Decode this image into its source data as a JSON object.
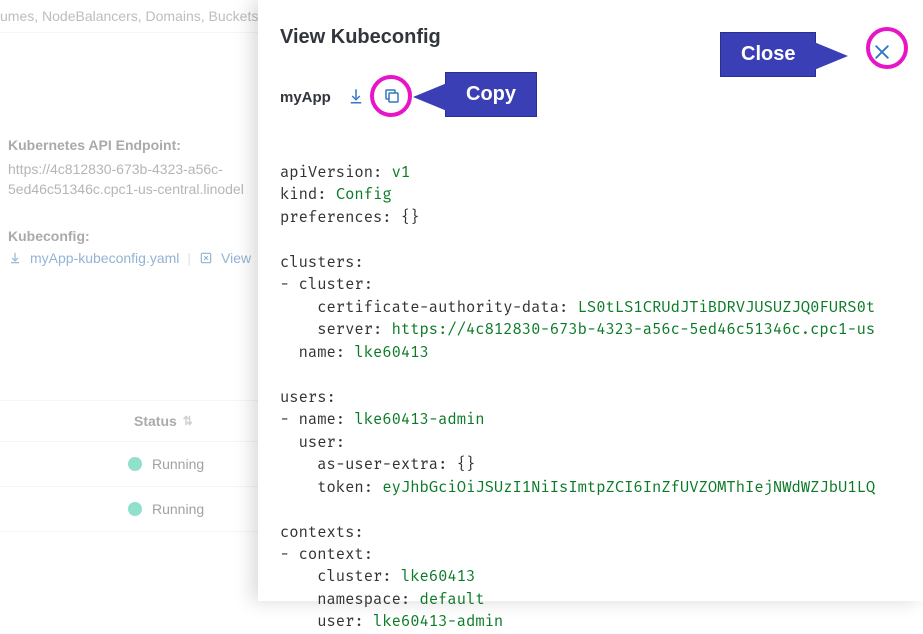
{
  "bg": {
    "searchHint": "umes, NodeBalancers, Domains, Buckets,",
    "apiLabel": "Kubernetes API Endpoint:",
    "apiValue": "https://4c812830-673b-4323-a56c-5ed46c51346c.cpc1-us-central.linodel",
    "kubeLabel": "Kubeconfig:",
    "kubeFile": "myApp-kubeconfig.yaml",
    "viewLink": "View",
    "statusHeader": "Status",
    "rowStatus1": "Running",
    "rowStatus2": "Running"
  },
  "drawer": {
    "title": "View Kubeconfig",
    "appName": "myApp"
  },
  "callouts": {
    "copy": "Copy",
    "close": "Close"
  },
  "yaml": {
    "apiVersionKey": "apiVersion: ",
    "apiVersion": "v1",
    "kindKey": "kind: ",
    "kind": "Config",
    "preferencesLine": "preferences: {}",
    "clustersKey": "clusters:",
    "clusterDash": "- cluster:",
    "certKey": "    certificate-authority-data: ",
    "certVal": "LS0tLS1CRUdJTiBDRVJUSUZJQ0FURS0t",
    "serverKey": "    server: ",
    "serverVal": "https://4c812830-673b-4323-a56c-5ed46c51346c.cpc1-us",
    "nameKey": "  name: ",
    "nameVal": "lke60413",
    "usersKey": "users:",
    "userNameDashKey": "- name: ",
    "userNameVal": "lke60413-admin",
    "userKey": "  user:",
    "asUserExtra": "    as-user-extra: {}",
    "tokenKey": "    token: ",
    "tokenVal": "eyJhbGciOiJSUzI1NiIsImtpZCI6InZfUVZOMThIejNWdWZJbU1LQ",
    "contextsKey": "contexts:",
    "contextDash": "- context:",
    "ctxClusterKey": "    cluster: ",
    "ctxClusterVal": "lke60413",
    "ctxNamespaceKey": "    namespace: ",
    "ctxNamespaceVal": "default",
    "ctxUserKey": "    user: ",
    "ctxUserVal": "lke60413-admin"
  }
}
